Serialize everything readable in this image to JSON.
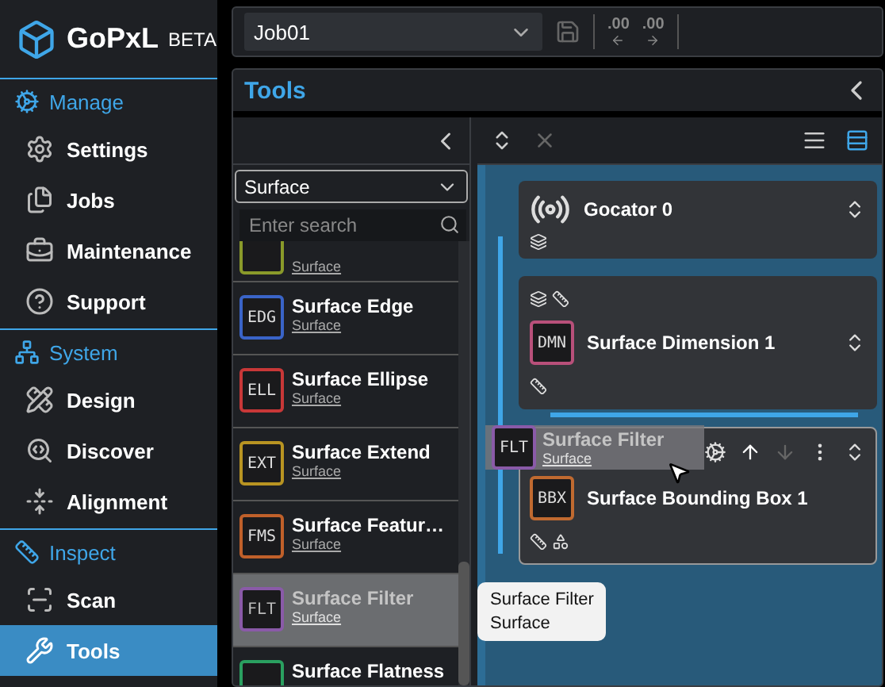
{
  "app": {
    "logo": "GoPxL",
    "badge": "BETA"
  },
  "sidebar": [
    {
      "title": "Manage",
      "items": [
        {
          "label": "Settings",
          "selected": false
        },
        {
          "label": "Jobs",
          "selected": false
        },
        {
          "label": "Maintenance",
          "selected": false
        },
        {
          "label": "Support",
          "selected": false
        }
      ]
    },
    {
      "title": "System",
      "items": [
        {
          "label": "Design",
          "selected": false
        },
        {
          "label": "Discover",
          "selected": false
        },
        {
          "label": "Alignment",
          "selected": false
        }
      ]
    },
    {
      "title": "Inspect",
      "items": [
        {
          "label": "Scan",
          "selected": false
        },
        {
          "label": "Tools",
          "selected": true
        }
      ]
    }
  ],
  "toolbar": {
    "job": "Job01",
    "decimal_buttons": [
      ".00",
      ".00"
    ]
  },
  "panel": {
    "title": "Tools"
  },
  "tool_list": {
    "filter": "Surface",
    "search": {
      "placeholder": "Enter search"
    },
    "items": [
      {
        "subtitle": "Surface",
        "color": "#8a9a2a",
        "selected": false
      },
      {
        "code": "EDG",
        "title": "Surface Edge",
        "subtitle": "Surface",
        "color": "#3a64c8",
        "selected": false
      },
      {
        "code": "ELL",
        "title": "Surface Ellipse",
        "subtitle": "Surface",
        "color": "#c83838",
        "selected": false
      },
      {
        "code": "EXT",
        "title": "Surface Extend",
        "subtitle": "Surface",
        "color": "#b89422",
        "selected": false
      },
      {
        "code": "FMS",
        "title": "Surface Featur…",
        "subtitle": "Surface",
        "color": "#c0602a",
        "selected": false
      },
      {
        "code": "FLT",
        "title": "Surface Filter",
        "subtitle": "Surface",
        "color": "#8a5aa8",
        "selected": true
      },
      {
        "title": "Surface Flatness",
        "color": "#2aa060",
        "selected": false
      }
    ]
  },
  "canvas": {
    "nodes": [
      {
        "kind": "sensor",
        "title": "Gocator 0",
        "selected": false
      },
      {
        "kind": "tool",
        "title": "Surface Dimension 1",
        "code": "DMN",
        "color": "#b8507a",
        "selected": false
      },
      {
        "kind": "tool",
        "title": "Surface Bounding Box 1",
        "code": "BBX",
        "color": "#c06a30",
        "selected": true
      }
    ]
  },
  "drag_ghost": {
    "code": "FLT",
    "title": "Surface Filter",
    "subtitle": "Surface",
    "color": "#8a5aa8"
  },
  "tooltip": {
    "lines": [
      "Surface Filter",
      "Surface"
    ]
  }
}
